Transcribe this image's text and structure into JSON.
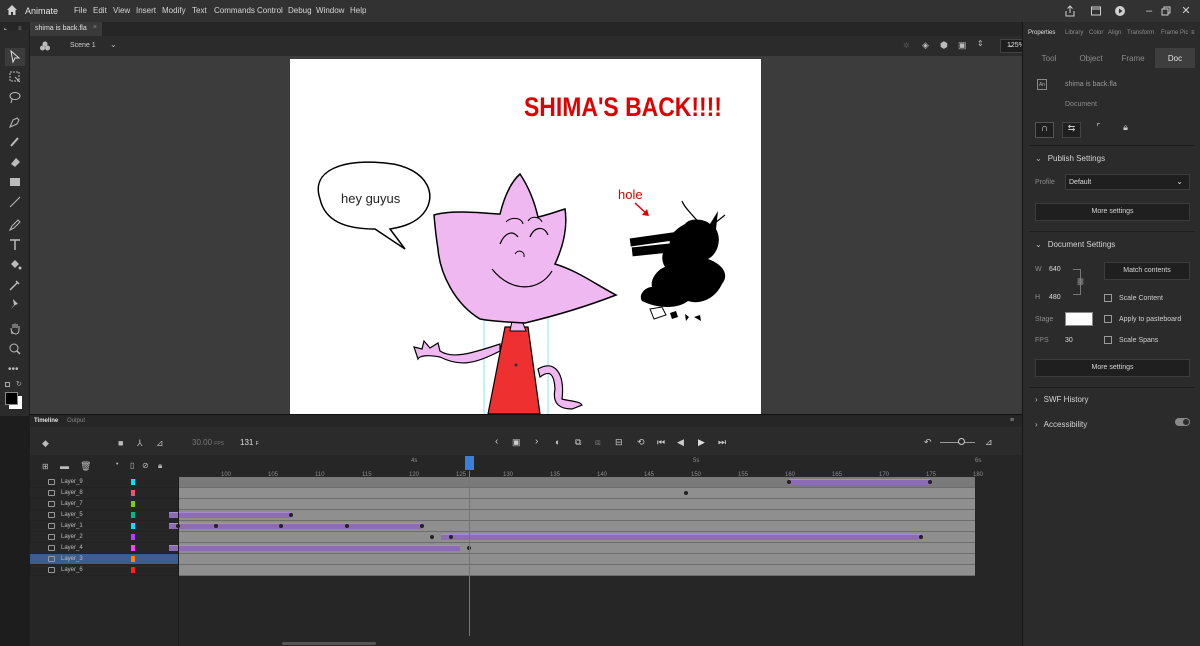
{
  "app": {
    "name": "Animate"
  },
  "menu": [
    "File",
    "Edit",
    "View",
    "Insert",
    "Modify",
    "Text",
    "Commands",
    "Control",
    "Debug",
    "Window",
    "Help"
  ],
  "document": {
    "tab": "shima is back.fla",
    "scene": "Scene 1",
    "zoom": "125%"
  },
  "stage_content": {
    "title_text": "SHIMA'S BACK!!!!",
    "speech": "hey guyus",
    "annotation": "hole",
    "title_color": "#e00000",
    "character_color": "#f0b8f0",
    "shirt_color": "#ee3030"
  },
  "properties": {
    "tabs": [
      "Properties",
      "Library",
      "Color",
      "Align",
      "Transform",
      "Frame Pic"
    ],
    "subtabs": [
      "Tool",
      "Object",
      "Frame",
      "Doc"
    ],
    "file_name": "shima is back.fla",
    "doc_label": "Document",
    "publish_settings": "Publish Settings",
    "profile_label": "Profile",
    "profile_value": "Default",
    "more_settings": "More settings",
    "document_settings": "Document Settings",
    "w_label": "W",
    "w_value": "640",
    "h_label": "H",
    "h_value": "480",
    "match_contents": "Match contents",
    "scale_content": "Scale Content",
    "stage_label": "Stage",
    "apply_pasteboard": "Apply to pasteboard",
    "fps_label": "FPS",
    "fps_value": "30",
    "scale_spans": "Scale Spans",
    "more_settings_2": "More settings",
    "swf_history": "SWF History",
    "accessibility": "Accessibility"
  },
  "timeline": {
    "tabs": [
      "Timeline",
      "Output"
    ],
    "fps": "30.00",
    "fps_unit": "FPS",
    "current_frame": "131",
    "frame_unit": "F",
    "seconds_marks": [
      "4s",
      "5s",
      "6s"
    ],
    "ruler": [
      "100",
      "105",
      "110",
      "115",
      "120",
      "125",
      "130",
      "135",
      "140",
      "145",
      "150",
      "155",
      "160",
      "165",
      "170",
      "175",
      "180"
    ],
    "layers": [
      {
        "name": "Layer_9",
        "color": "#00e5ff"
      },
      {
        "name": "Layer_8",
        "color": "#ff4d6d"
      },
      {
        "name": "Layer_7",
        "color": "#7fd000"
      },
      {
        "name": "Layer_5",
        "color": "#00b890"
      },
      {
        "name": "Layer_1",
        "color": "#00e5ff"
      },
      {
        "name": "Layer_2",
        "color": "#b040ff"
      },
      {
        "name": "Layer_4",
        "color": "#ff40ff"
      },
      {
        "name": "Layer_3",
        "color": "#ff8800"
      },
      {
        "name": "Layer_6",
        "color": "#ff2020"
      }
    ],
    "selected_layer": "Layer_3",
    "tweens": [
      {
        "layer": 0,
        "from": 165,
        "to": 180
      },
      {
        "layer": 3,
        "from": 99,
        "to": 112
      },
      {
        "layer": 4,
        "from": 99,
        "to": 126
      },
      {
        "layer": 5,
        "from": 128,
        "to": 179
      },
      {
        "layer": 6,
        "from": 99,
        "to": 130
      }
    ],
    "keyframes": [
      {
        "layer": 0,
        "frame": 165
      },
      {
        "layer": 0,
        "frame": 180
      },
      {
        "layer": 1,
        "frame": 154
      },
      {
        "layer": 3,
        "frame": 112
      },
      {
        "layer": 4,
        "frame": 100
      },
      {
        "layer": 4,
        "frame": 104
      },
      {
        "layer": 4,
        "frame": 111
      },
      {
        "layer": 4,
        "frame": 118
      },
      {
        "layer": 4,
        "frame": 126
      },
      {
        "layer": 5,
        "frame": 127
      },
      {
        "layer": 5,
        "frame": 129
      },
      {
        "layer": 5,
        "frame": 179
      },
      {
        "layer": 6,
        "frame": 131
      }
    ]
  }
}
